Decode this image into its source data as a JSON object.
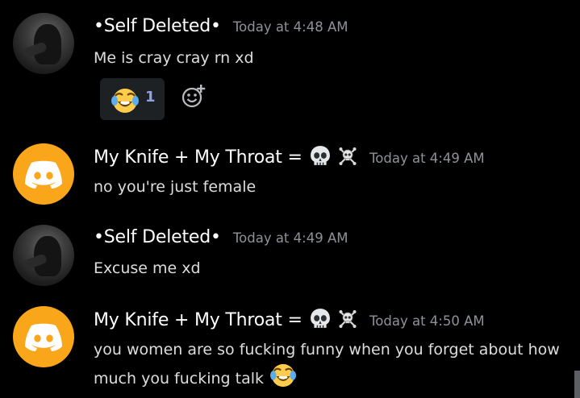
{
  "messages": [
    {
      "username": "•Self Deleted•",
      "timestamp": "Today at 4:48 AM",
      "text": "Me is cray cray rn xd",
      "avatar": "photo",
      "reaction": {
        "emoji": "joy-emoji",
        "count": "1"
      }
    },
    {
      "username": "My Knife + My Throat =",
      "username_emojis": [
        "skull-emoji",
        "skull-crossbones-emoji"
      ],
      "timestamp": "Today at 4:49 AM",
      "text": "no you're just female",
      "avatar": "discord-logo"
    },
    {
      "username": "•Self Deleted•",
      "timestamp": "Today at 4:49 AM",
      "text": "Excuse me xd",
      "avatar": "photo"
    },
    {
      "username": "My Knife + My Throat =",
      "username_emojis": [
        "skull-emoji",
        "skull-crossbones-emoji"
      ],
      "timestamp": "Today at 4:50 AM",
      "text_line1": "you women are so fucking funny when you forget about how",
      "text_line2": "much you fucking talk",
      "trailing_emoji": "joy-emoji",
      "avatar": "discord-logo"
    }
  ],
  "colors": {
    "background": "#000000",
    "username": "#ffffff",
    "timestamp": "#8e9297",
    "text": "#dcddde",
    "reaction_bg": "#1e2124",
    "reaction_count": "#8ea1e1",
    "discord_avatar": "#faa61a"
  }
}
